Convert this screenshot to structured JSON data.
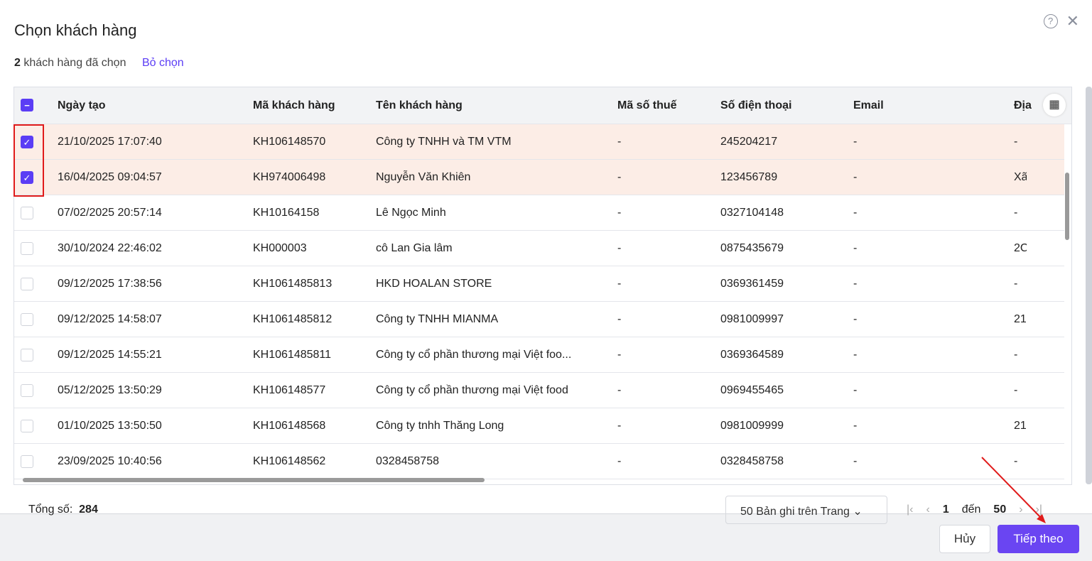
{
  "title": "Chọn khách hàng",
  "selection": {
    "count": "2",
    "text": "khách hàng đã chọn",
    "unselect": "Bỏ chọn"
  },
  "columns": [
    "Ngày tạo",
    "Mã khách hàng",
    "Tên khách hàng",
    "Mã số thuế",
    "Số điện thoại",
    "Email",
    "Địa"
  ],
  "rows": [
    [
      "21/10/2025 17:07:40",
      "KH106148570",
      "Công ty TNHH và TM VTM",
      "-",
      "245204217",
      "-",
      "-"
    ],
    [
      "16/04/2025 09:04:57",
      "KH974006498",
      "Nguyễn Văn Khiên",
      "-",
      "123456789",
      "-",
      "Xã"
    ],
    [
      "07/02/2025 20:57:14",
      "KH10164158",
      "Lê Ngọc Minh",
      "-",
      "0327104148",
      "-",
      "-"
    ],
    [
      "30/10/2024 22:46:02",
      "KH000003",
      "cô Lan Gia lâm",
      "-",
      "0875435679",
      "-",
      "2C"
    ],
    [
      "09/12/2025 17:38:56",
      "KH1061485813",
      "HKD HOALAN STORE",
      "-",
      "0369361459",
      "-",
      "-"
    ],
    [
      "09/12/2025 14:58:07",
      "KH1061485812",
      "Công ty TNHH MIANMA",
      "-",
      "0981009997",
      "-",
      "21"
    ],
    [
      "09/12/2025 14:55:21",
      "KH1061485811",
      "Công ty cổ phần thương mại Việt foo...",
      "-",
      "0369364589",
      "-",
      "-"
    ],
    [
      "05/12/2025 13:50:29",
      "KH106148577",
      "Công ty cổ phần thương mại Việt food",
      "-",
      "0969455465",
      "-",
      "-"
    ],
    [
      "01/10/2025 13:50:50",
      "KH106148568",
      "Công ty tnhh Thăng Long",
      "-",
      "0981009999",
      "-",
      "21"
    ],
    [
      "23/09/2025 10:40:56",
      "KH106148562",
      "0328458758",
      "-",
      "0328458758",
      "-",
      "-"
    ]
  ],
  "selected": [
    true,
    true,
    false,
    false,
    false,
    false,
    false,
    false,
    false,
    false
  ],
  "footer": {
    "total_label": "Tổng số:",
    "total": "284",
    "page_size": "50 Bản ghi trên Trang",
    "page": "1",
    "to_label": "đến",
    "page_end": "50",
    "cancel": "Hủy",
    "next": "Tiếp theo"
  }
}
